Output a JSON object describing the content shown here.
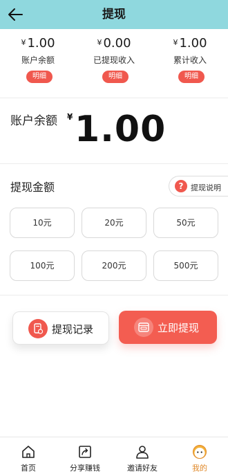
{
  "header": {
    "title": "提现",
    "back_icon": "arrow-left-icon"
  },
  "stats": [
    {
      "currency": "¥",
      "value": "1.00",
      "label": "账户余额",
      "button": "明细"
    },
    {
      "currency": "¥",
      "value": "0.00",
      "label": "已提现收入",
      "button": "明细"
    },
    {
      "currency": "¥",
      "value": "1.00",
      "label": "累计收入",
      "button": "明细"
    }
  ],
  "balance": {
    "label": "账户余额",
    "currency": "¥",
    "value": "1.00"
  },
  "withdraw": {
    "title": "提现金额",
    "help_label": "提现说明",
    "amounts": [
      "10元",
      "20元",
      "50元",
      "100元",
      "200元",
      "500元"
    ]
  },
  "actions": {
    "record_label": "提现记录",
    "withdraw_label": "立即提现"
  },
  "tabs": [
    {
      "label": "首页",
      "icon": "home-icon"
    },
    {
      "label": "分享赚钱",
      "icon": "share-icon"
    },
    {
      "label": "邀请好友",
      "icon": "person-icon"
    },
    {
      "label": "我的",
      "icon": "profile-face-icon",
      "active": true
    }
  ],
  "colors": {
    "header_bg": "#8fd8de",
    "accent": "#f0584e",
    "active_tab": "#e0892a"
  }
}
